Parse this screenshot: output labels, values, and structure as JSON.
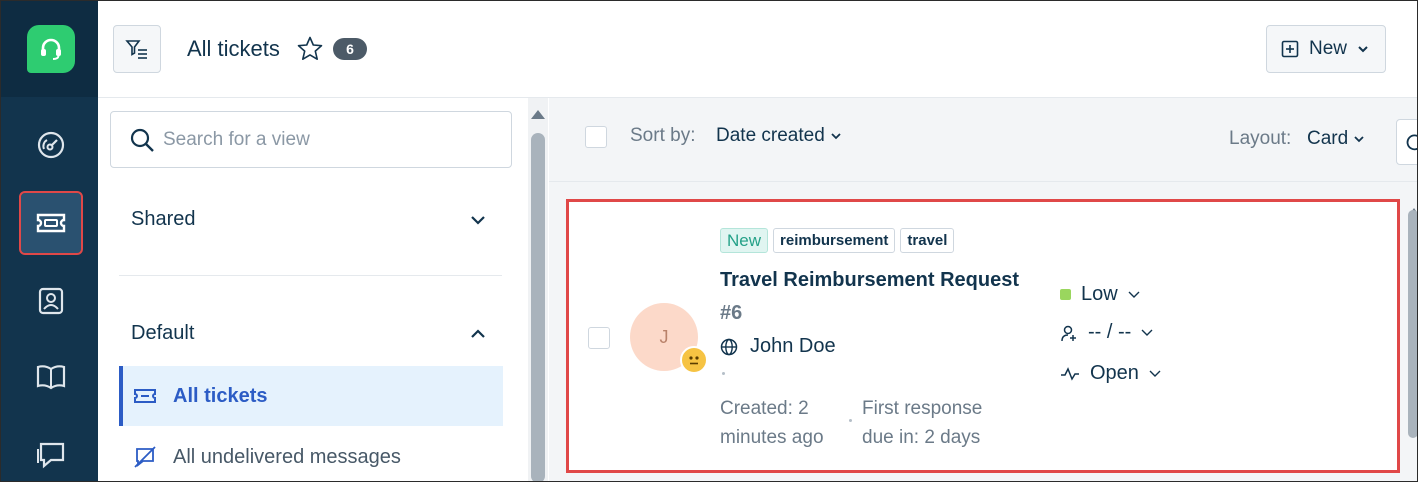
{
  "rail": {
    "items": [
      {
        "name": "dashboard-icon"
      },
      {
        "name": "tickets-icon",
        "active": true
      },
      {
        "name": "contacts-icon"
      },
      {
        "name": "knowledge-base-icon"
      },
      {
        "name": "chat-icon"
      }
    ],
    "accent_color": "#2ecc71",
    "active_outline_color": "#e04848"
  },
  "header": {
    "title": "All tickets",
    "count": "6",
    "new_button_label": "New"
  },
  "views": {
    "search_placeholder": "Search for a view",
    "shared_label": "Shared",
    "default_label": "Default",
    "items": [
      {
        "label": "All tickets",
        "icon": "ticket-icon",
        "active": true
      },
      {
        "label": "All undelivered messages",
        "icon": "undelivered-icon",
        "active": false
      }
    ]
  },
  "toolbar": {
    "sort_label": "Sort by:",
    "sort_value": "Date created",
    "layout_label": "Layout:",
    "layout_value": "Card"
  },
  "ticket": {
    "tags": [
      "New",
      "reimbursement",
      "travel"
    ],
    "subject": "Travel Reimbursement Request",
    "number": "#6",
    "avatar_initial": "J",
    "requester": "John Doe",
    "created": "Created: 2 minutes ago",
    "first_response": "First response due in: 2 days",
    "priority": "Low",
    "assignee": "-- / --",
    "status": "Open",
    "priority_color": "#9ad65e"
  }
}
